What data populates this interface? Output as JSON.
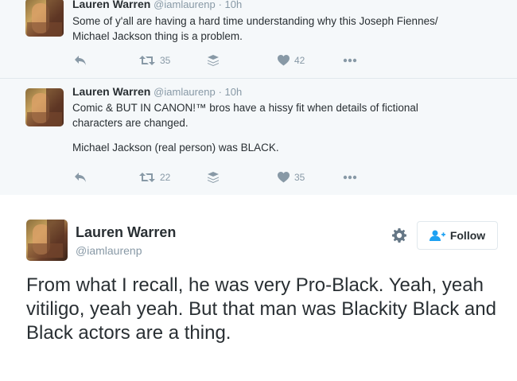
{
  "thread": [
    {
      "name": "Lauren Warren",
      "handle": "@iamlaurenp",
      "time": "· 10h",
      "text": [
        "Some of y'all are having a hard time understanding why this Joseph Fiennes/",
        "Michael Jackson thing is a problem."
      ],
      "retweets": "35",
      "likes": "42"
    },
    {
      "name": "Lauren Warren",
      "handle": "@iamlaurenp",
      "time": "· 10h",
      "text": [
        "Comic & BUT IN CANON!™ bros have a hissy fit when details of fictional",
        "characters are changed."
      ],
      "text2": "Michael Jackson (real person) was BLACK.",
      "retweets": "22",
      "likes": "35"
    }
  ],
  "main": {
    "name": "Lauren Warren",
    "handle": "@iamlaurenp",
    "follow_label": "Follow",
    "text": "From what I recall, he was very Pro-Black. Yeah, yeah vitiligo, yeah yeah. But that man was Blackity Black and Black actors are a thing."
  },
  "colors": {
    "thread_bg": "#f5f8fa",
    "icon_gray": "#8899a6",
    "text_dark": "#292f33",
    "follow_blue": "#1da1f2"
  },
  "icons": [
    "reply-icon",
    "retweet-icon",
    "buffer-stack-icon",
    "heart-icon",
    "more-dots-icon",
    "gear-icon",
    "follow-person-icon"
  ]
}
